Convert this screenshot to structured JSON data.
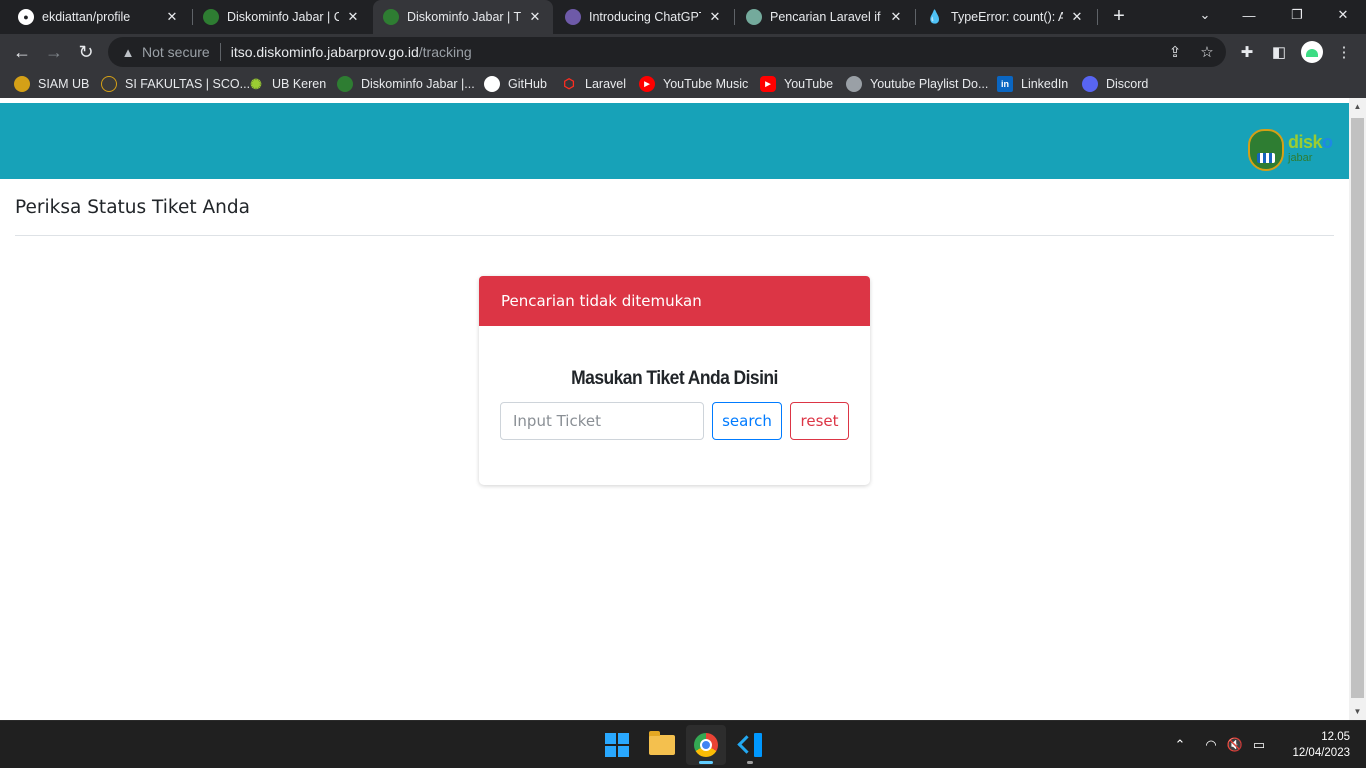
{
  "browser": {
    "tabs": [
      {
        "title": "ekdiattan/profile",
        "icon": "github-icon"
      },
      {
        "title": "Diskominfo Jabar | Cat",
        "icon": "diskominfo-icon"
      },
      {
        "title": "Diskominfo Jabar | Tra",
        "icon": "diskominfo-icon",
        "active": true
      },
      {
        "title": "Introducing ChatGPT",
        "icon": "openai-icon"
      },
      {
        "title": "Pencarian Laravel if els",
        "icon": "chatgpt-icon"
      },
      {
        "title": "TypeError: count(): Arg",
        "icon": "drupal-icon"
      }
    ],
    "address": {
      "security_label": "Not secure",
      "host": "itso.diskominfo.jabarprov.go.id",
      "path": "/tracking"
    },
    "bookmarks": [
      {
        "label": "SIAM UB",
        "icon": "siam-icon"
      },
      {
        "label": "SI FAKULTAS | SCO...",
        "icon": "fakultas-icon"
      },
      {
        "label": "UB Keren",
        "icon": "ub-keren-icon"
      },
      {
        "label": "Diskominfo Jabar |...",
        "icon": "diskominfo-icon"
      },
      {
        "label": "GitHub",
        "icon": "github-icon"
      },
      {
        "label": "Laravel",
        "icon": "laravel-icon"
      },
      {
        "label": "YouTube Music",
        "icon": "youtube-music-icon"
      },
      {
        "label": "YouTube",
        "icon": "youtube-icon"
      },
      {
        "label": "Youtube Playlist Do...",
        "icon": "globe-icon"
      },
      {
        "label": "LinkedIn",
        "icon": "linkedin-icon"
      },
      {
        "label": "Discord",
        "icon": "discord-icon"
      }
    ]
  },
  "page": {
    "logo": {
      "text_main": "disk",
      "text_accent": "o",
      "text_sub": "jabar"
    },
    "title": "Periksa Status Tiket Anda",
    "alert": "Pencarian tidak ditemukan",
    "card_heading": "Masukan Tiket Anda Disini",
    "input_placeholder": "Input Ticket",
    "input_value": "",
    "search_label": "search",
    "reset_label": "reset"
  },
  "taskbar": {
    "time": "12.05",
    "date": "12/04/2023"
  },
  "colors": {
    "header": "#17a2b8",
    "alert": "#dc3545",
    "primary": "#007bff",
    "danger": "#dc3545"
  }
}
